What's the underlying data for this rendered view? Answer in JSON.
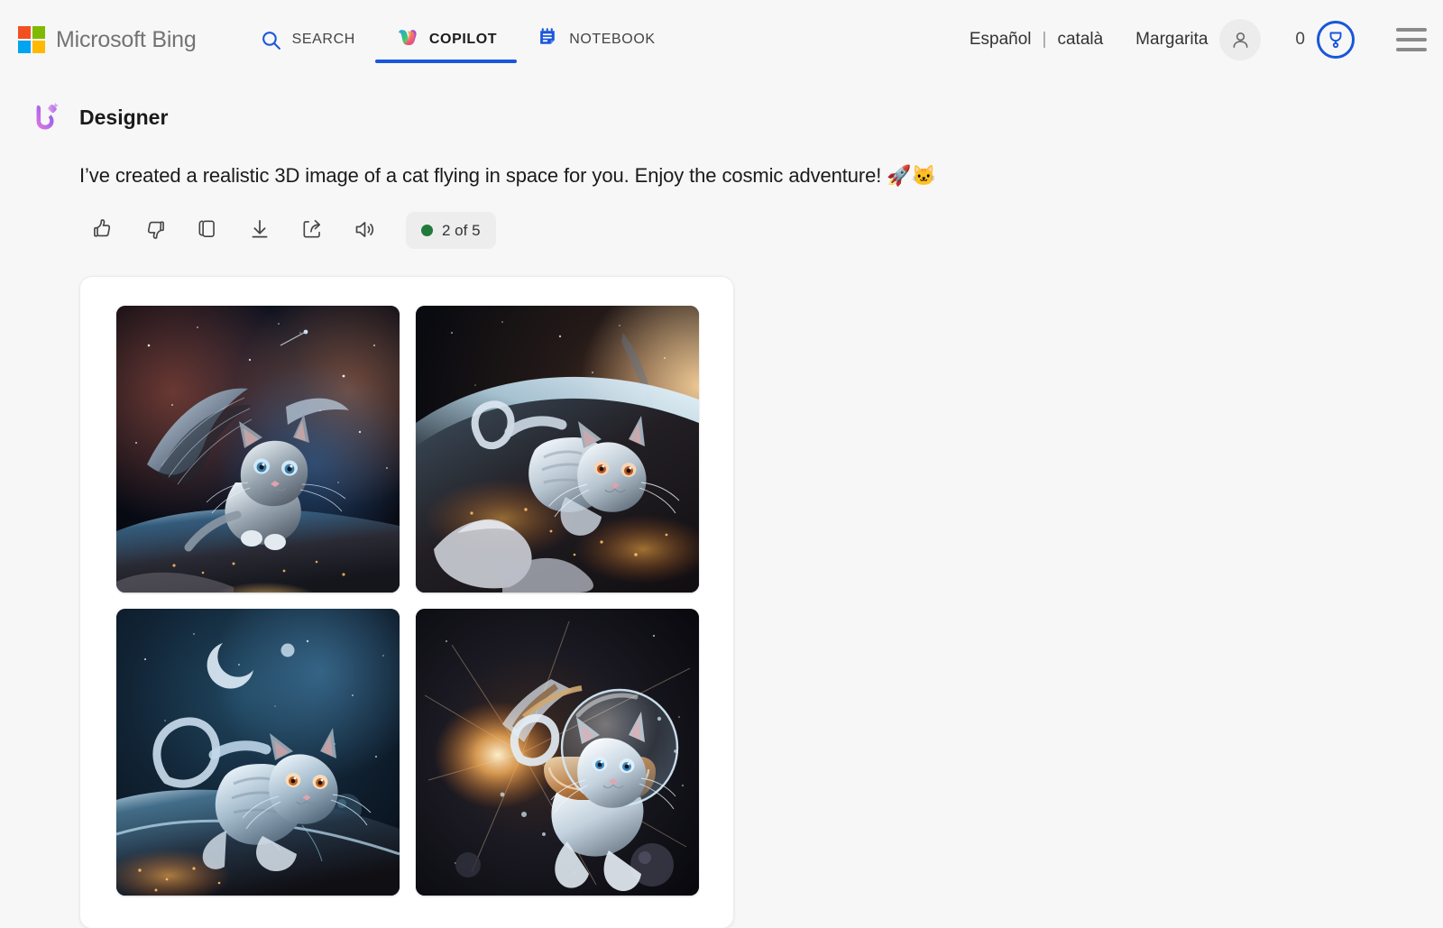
{
  "header": {
    "brand": {
      "name": "Microsoft Bing",
      "logo_icon": "microsoft-logo-icon",
      "colors": {
        "q1": "#f25022",
        "q2": "#7fba00",
        "q3": "#00a4ef",
        "q4": "#ffb900"
      }
    },
    "nav": [
      {
        "label": "SEARCH",
        "icon": "search-icon",
        "active": false
      },
      {
        "label": "COPILOT",
        "icon": "copilot-icon",
        "active": true
      },
      {
        "label": "NOTEBOOK",
        "icon": "notebook-icon",
        "active": false
      }
    ],
    "active_tab_color": "#1a56db",
    "languages": {
      "primary": "Español",
      "separator": "|",
      "secondary": "català"
    },
    "user": {
      "name": "Margarita",
      "avatar_icon": "person-avatar-icon"
    },
    "rewards": {
      "count": "0",
      "badge_icon": "rewards-medal-icon",
      "color": "#1a56db"
    },
    "menu": {
      "icon": "hamburger-menu-icon"
    }
  },
  "conversation": {
    "agent": {
      "name": "Designer",
      "icon": "designer-wand-icon"
    },
    "message": "I’ve created a realistic 3D image of a cat flying in space for you. Enjoy the cosmic adventure! 🚀🐱",
    "actions": [
      {
        "name": "thumbs-up",
        "icon": "thumbs-up-icon",
        "title": "Like"
      },
      {
        "name": "thumbs-down",
        "icon": "thumbs-down-icon",
        "title": "Dislike"
      },
      {
        "name": "copy",
        "icon": "copy-icon",
        "title": "Copy"
      },
      {
        "name": "download",
        "icon": "download-icon",
        "title": "Download"
      },
      {
        "name": "share",
        "icon": "share-icon",
        "title": "Share"
      },
      {
        "name": "speak",
        "icon": "speaker-icon",
        "title": "Read aloud"
      }
    ],
    "counter": {
      "text": "2 of 5",
      "dot_color": "#217a3c"
    }
  },
  "image_results": {
    "count": 4,
    "items": [
      {
        "alt": "Winged tabby kitten gliding above Earth in a starry nebula",
        "theme": "nebula-angel-cat"
      },
      {
        "alt": "Glowing white cat leaping above a fiery cloudscape of Earth",
        "theme": "orbit-sunrise-cat"
      },
      {
        "alt": "Blue-lit cat floating near a crescent moon over Earth",
        "theme": "moonlight-cat"
      },
      {
        "alt": "Cat in a glass space helmet with a sunburst behind it",
        "theme": "astronaut-helmet-cat"
      }
    ]
  }
}
